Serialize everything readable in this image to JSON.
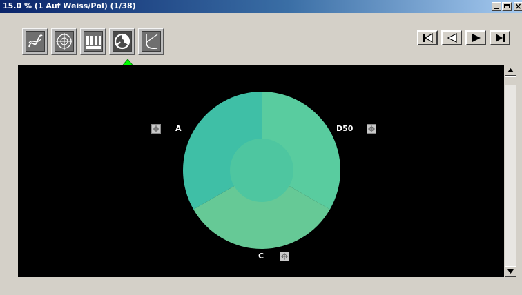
{
  "window": {
    "title": "15.0 %  (1 Auf Weiss/Pol)  (1/38)",
    "minimize_label": "",
    "maximize_label": "",
    "close_label": "×"
  },
  "toolbar": {
    "view_buttons": [
      {
        "icon": "curve-graph-icon"
      },
      {
        "icon": "crosshair-target-icon"
      },
      {
        "icon": "bar-columns-icon"
      },
      {
        "icon": "pie-chart-icon",
        "active": true
      },
      {
        "icon": "u-curve-icon"
      }
    ],
    "indicator_icon": "green-up-arrow-icon",
    "indicator_color": "#00ff00"
  },
  "navigation": {
    "buttons": [
      "first-icon",
      "previous-icon",
      "next-icon",
      "last-icon"
    ]
  },
  "chart_data": {
    "type": "pie",
    "labels": [
      "A",
      "D50",
      "C"
    ],
    "values": [
      33.3,
      33.3,
      33.4
    ],
    "colors": [
      "#3fbfa6",
      "#59cc9f",
      "#66c996"
    ],
    "inner_disc_color": "#4ec6a0",
    "background": "#000000"
  }
}
